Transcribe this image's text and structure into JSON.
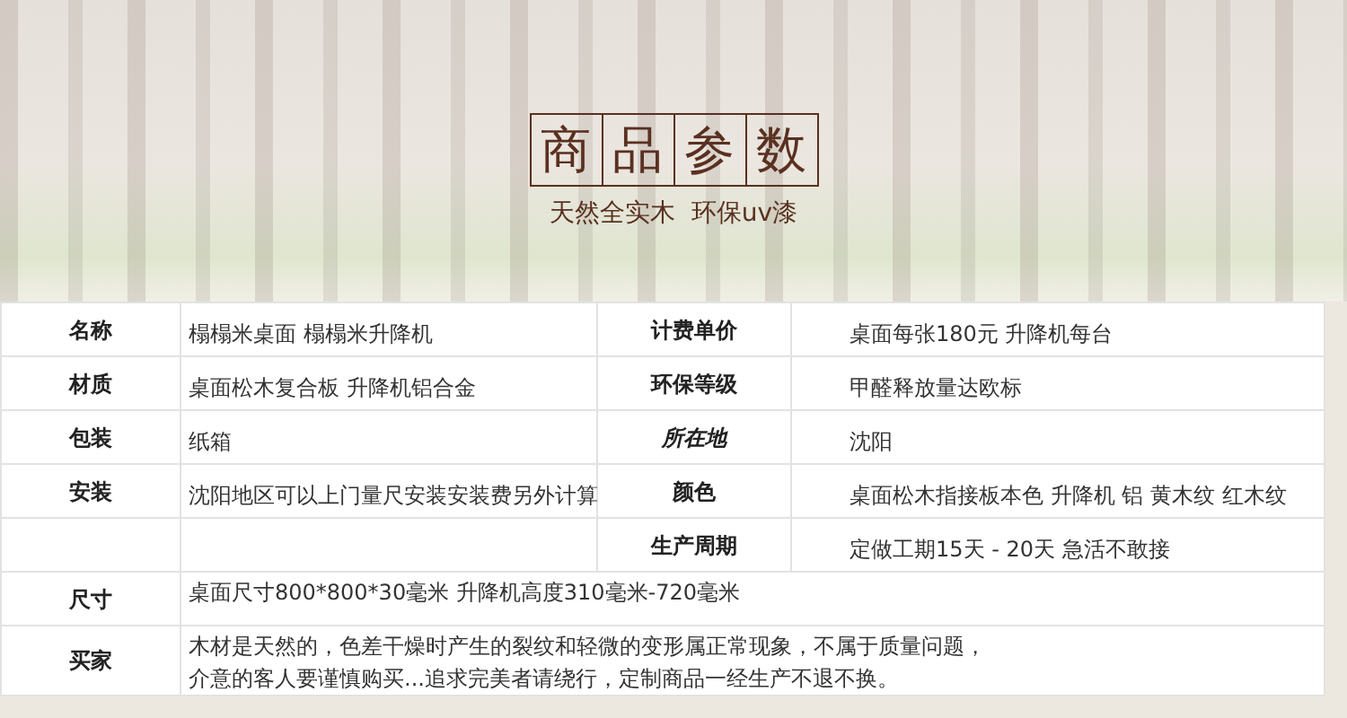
{
  "banner": {
    "title_chars": [
      "商",
      "品",
      "参",
      "数"
    ],
    "subtitle": "天然全实木  环保uv漆"
  },
  "rows": [
    {
      "kind": "pair",
      "left_label": {
        "text": "名称",
        "italic": false
      },
      "left_value": "榻榻米桌面  榻榻米升降机",
      "right_label": {
        "text": "计费单价",
        "italic": false
      },
      "right_value": "桌面每张180元  升降机每台"
    },
    {
      "kind": "pair",
      "left_label": {
        "text": "材质",
        "italic": false
      },
      "left_value": "桌面松木复合板 升降机铝合金",
      "right_label": {
        "text": "环保等级",
        "italic": false
      },
      "right_value": "甲醛释放量达欧标"
    },
    {
      "kind": "pair",
      "left_label": {
        "text": "包装",
        "italic": false
      },
      "left_value": "纸箱",
      "right_label": {
        "text": "所在地",
        "italic": true
      },
      "right_value": "沈阳"
    },
    {
      "kind": "pair",
      "left_label": {
        "text": "安装",
        "italic": false
      },
      "left_value": "沈阳地区可以上门量尺安装安装费另外计算",
      "right_label": {
        "text": "颜色",
        "italic": false
      },
      "right_value": "桌面松木指接板本色  升降机 铝  黄木纹 红木纹"
    },
    {
      "kind": "pair",
      "right_label": {
        "text": "生产周期",
        "italic": false
      },
      "right_value": "定做工期15天 - 20天  急活不敢接"
    },
    {
      "kind": "wide",
      "left_label": {
        "text": "尺寸",
        "italic": false
      },
      "lines": [
        "桌面尺寸800*800*30毫米  升降机高度310毫米-720毫米"
      ]
    },
    {
      "kind": "wide",
      "left_label": {
        "text": "买家",
        "italic": false
      },
      "lines": [
        "木材是天然的，色差干燥时产生的裂纹和轻微的变形属正常现象，不属于质量问题，",
        "介意的客人要谨慎购买...追求完美者请绕行，定制商品一经生产不退不换。"
      ]
    }
  ]
}
